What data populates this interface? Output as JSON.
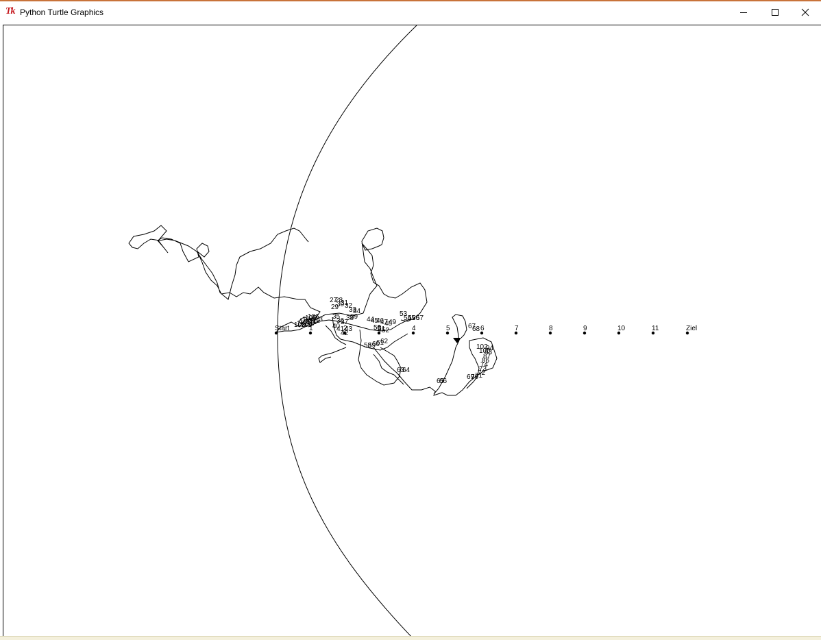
{
  "window": {
    "title": "Python Turtle Graphics",
    "app_icon_text": "Tk",
    "controls": {
      "minimize": "minimize-icon",
      "maximize": "maximize-icon",
      "close": "close-icon"
    }
  },
  "canvas": {
    "background": "#ffffff",
    "ink_color": "#000000",
    "track_labels": [
      "Start",
      "1",
      "2",
      "3",
      "4",
      "5",
      "6",
      "7",
      "8",
      "9",
      "10",
      "11",
      "Ziel"
    ],
    "step_labels": [
      "27",
      "28",
      "29",
      "30",
      "31",
      "32",
      "33",
      "34",
      "35",
      "36",
      "37",
      "38",
      "39",
      "40",
      "41",
      "42",
      "43",
      "44",
      "45",
      "46",
      "47",
      "48",
      "49",
      "50",
      "51",
      "52",
      "53",
      "54",
      "55",
      "56",
      "57",
      "58",
      "59",
      "60",
      "61",
      "62",
      "63",
      "64",
      "65",
      "66",
      "67",
      "68",
      "69",
      "70",
      "71",
      "72",
      "73",
      "74",
      "86",
      "87",
      "93",
      "94",
      "100",
      "102",
      "103",
      "104",
      "105",
      "106",
      "107",
      "108",
      "109",
      "110",
      "111",
      "112",
      "113"
    ]
  }
}
